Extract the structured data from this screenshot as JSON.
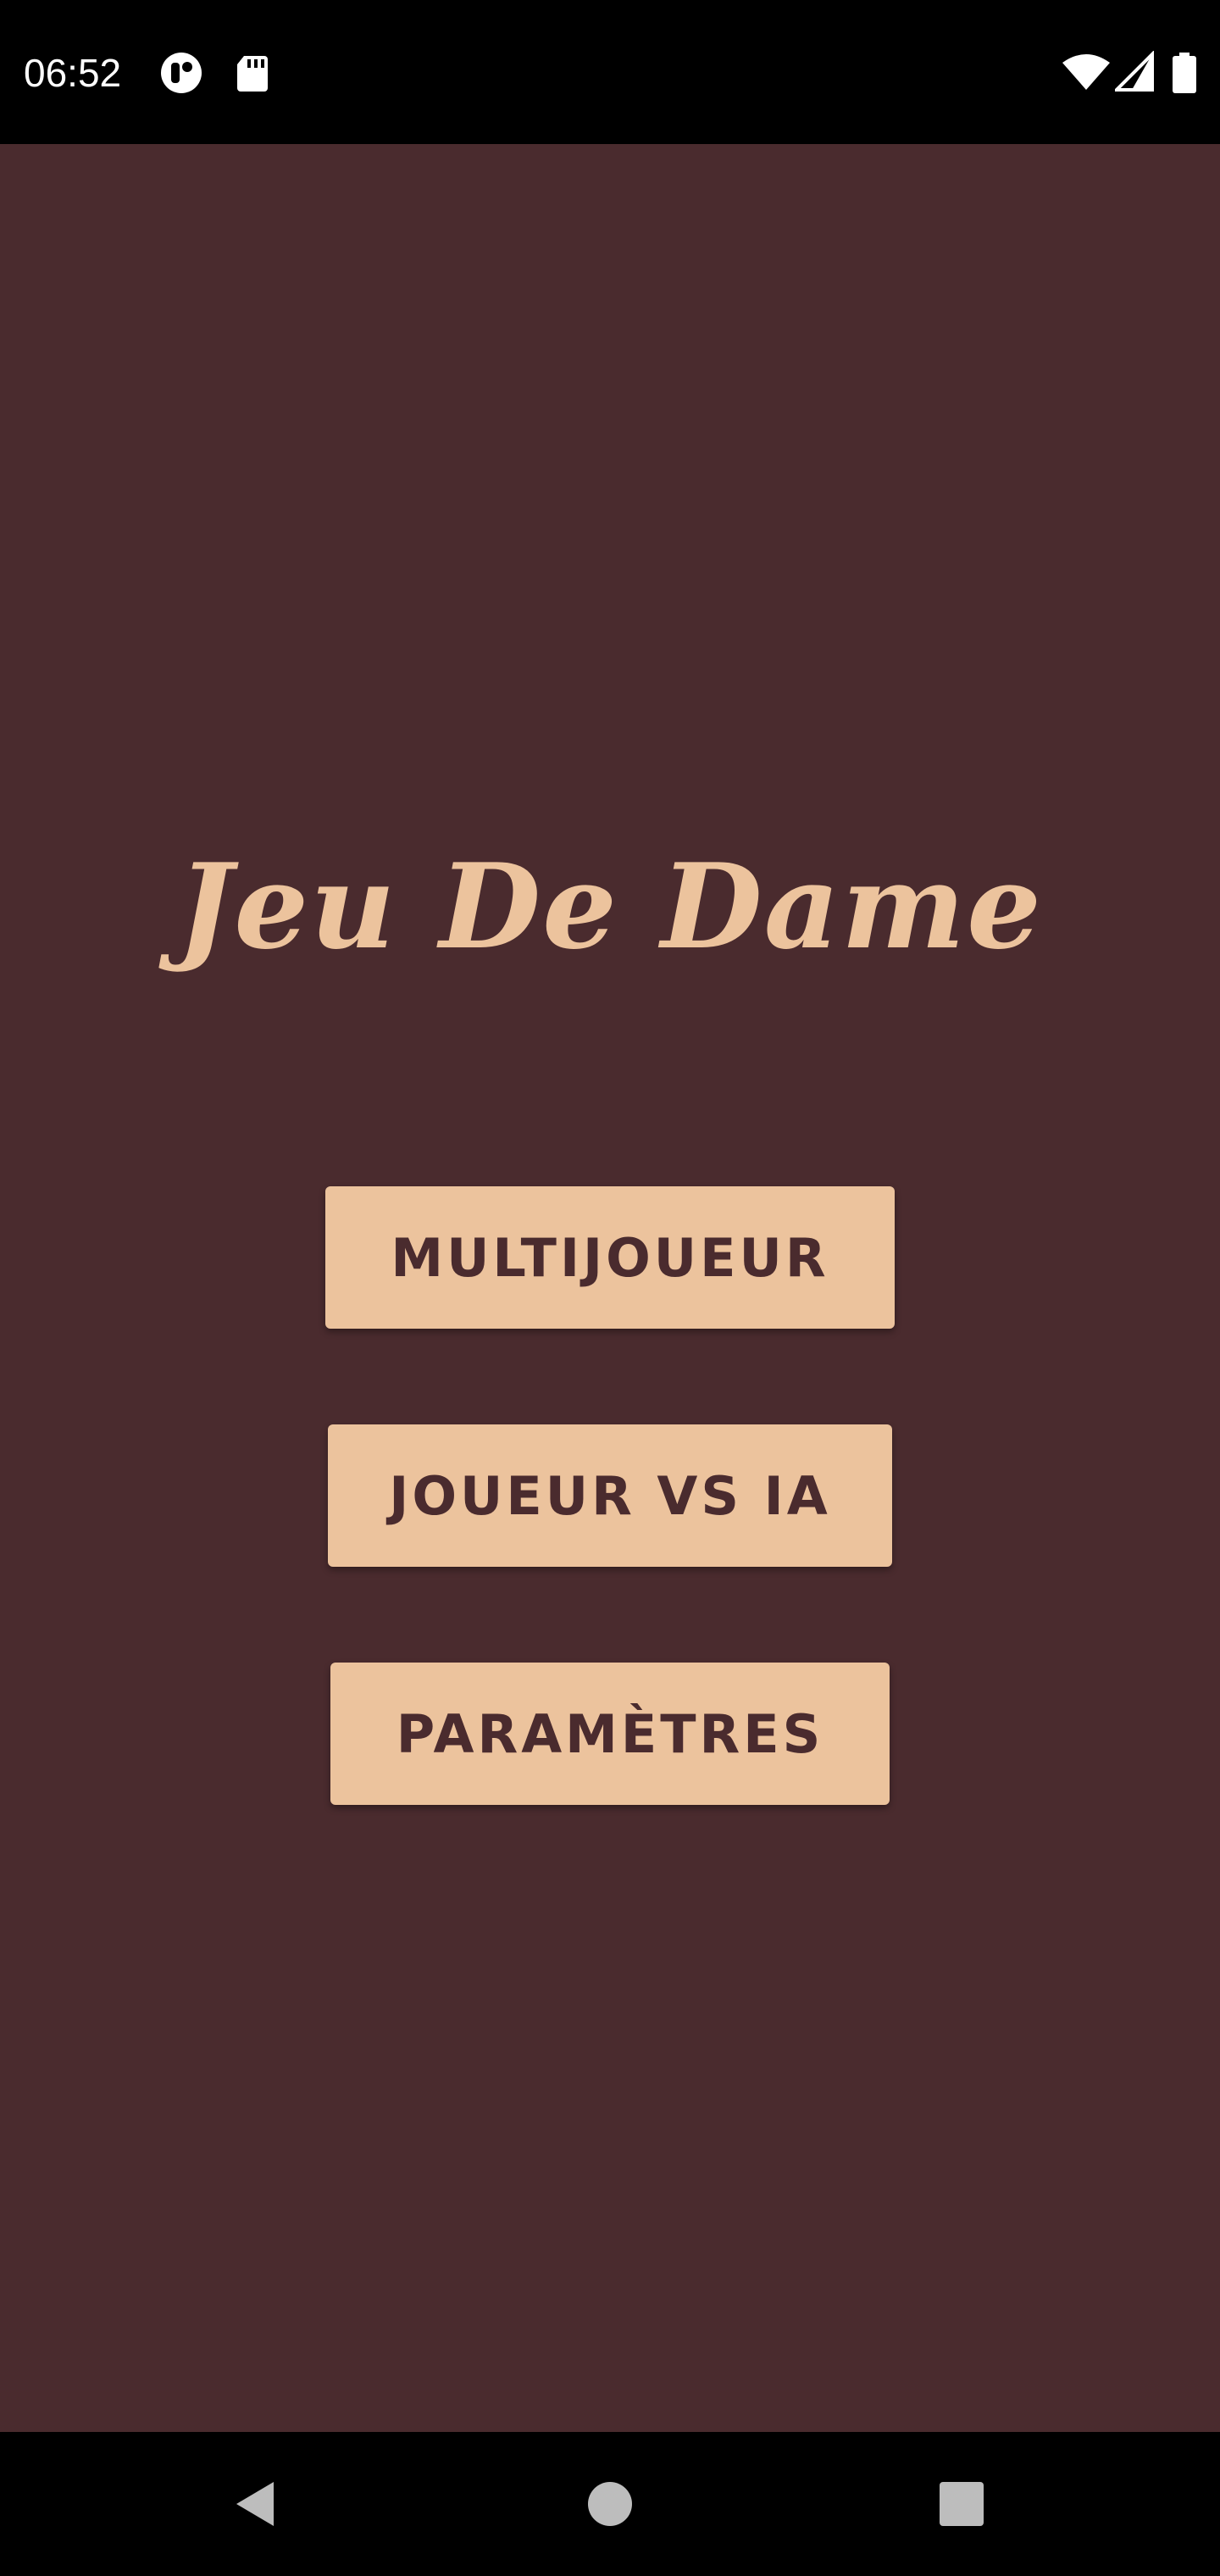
{
  "status_bar": {
    "time": "06:52",
    "icons": [
      "notification-app-icon",
      "sd-card-icon",
      "wifi-icon",
      "cell-signal-icon",
      "battery-icon"
    ]
  },
  "app": {
    "title": "Jeu De Dame",
    "background_color": "#4a2b2e",
    "accent_color": "#ecc39d"
  },
  "menu": {
    "multiplayer_label": "MULTIJOUEUR",
    "vs_ai_label": "JOUEUR VS IA",
    "settings_label": "PARAMÈTRES"
  },
  "nav_bar": {
    "icons": [
      "back-icon",
      "home-icon",
      "recents-icon"
    ]
  }
}
